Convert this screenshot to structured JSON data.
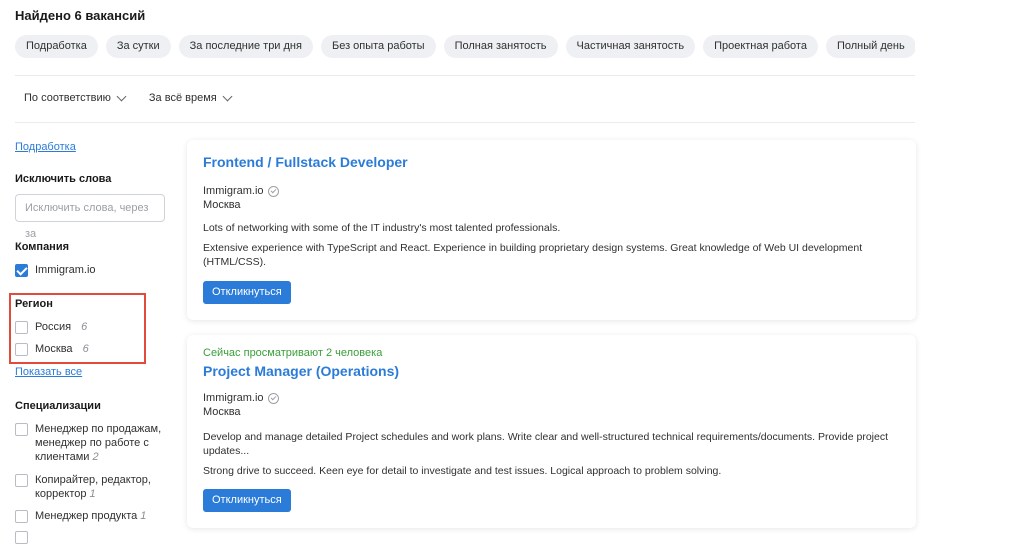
{
  "header": {
    "title": "Найдено 6 вакансий"
  },
  "chips": [
    "Подработка",
    "За сутки",
    "За последние три дня",
    "Без опыта работы",
    "Полная занятость",
    "Частичная занятость",
    "Проектная работа",
    "Полный день"
  ],
  "sort": {
    "relevance": "По соответствию",
    "period": "За всё время"
  },
  "sidebar": {
    "top_link": "Подработка",
    "exclude_heading": "Исключить слова",
    "exclude_placeholder": "Исключить слова, через за",
    "company_heading": "Компания",
    "company_item": "Immigram.io",
    "region_heading": "Регион",
    "regions": [
      {
        "label": "Россия",
        "count": "6"
      },
      {
        "label": "Москва",
        "count": "6"
      }
    ],
    "show_all": "Показать все",
    "spec_heading": "Специализации",
    "specs": [
      {
        "label": "Менеджер по продажам, менеджер по работе с клиентами",
        "count": "2"
      },
      {
        "label": "Копирайтер, редактор, корректор",
        "count": "1"
      },
      {
        "label": "Менеджер продукта",
        "count": "1"
      }
    ]
  },
  "jobs": [
    {
      "title": "Frontend / Fullstack Developer",
      "company": "Immigram.io",
      "city": "Москва",
      "desc1": "Lots of networking with some of the IT industry's most talented professionals.",
      "desc2": "Extensive experience with TypeScript and React. Experience in building proprietary design systems. Great knowledge of Web UI development (HTML/CSS).",
      "button": "Откликнуться"
    },
    {
      "viewing": "Сейчас просматривают 2 человека",
      "title": "Project Manager (Operations)",
      "company": "Immigram.io",
      "city": "Москва",
      "desc1": "Develop and manage detailed Project schedules and work plans. Write clear and well-structured technical requirements/documents. Provide project updates...",
      "desc2": "Strong drive to succeed. Keen eye for detail to investigate and test issues. Logical approach to problem solving.",
      "button": "Откликнуться"
    }
  ],
  "colors": {
    "accent": "#2b7bd8",
    "highlight_box": "#e24a3b",
    "viewing_text": "#3a9e3a"
  }
}
